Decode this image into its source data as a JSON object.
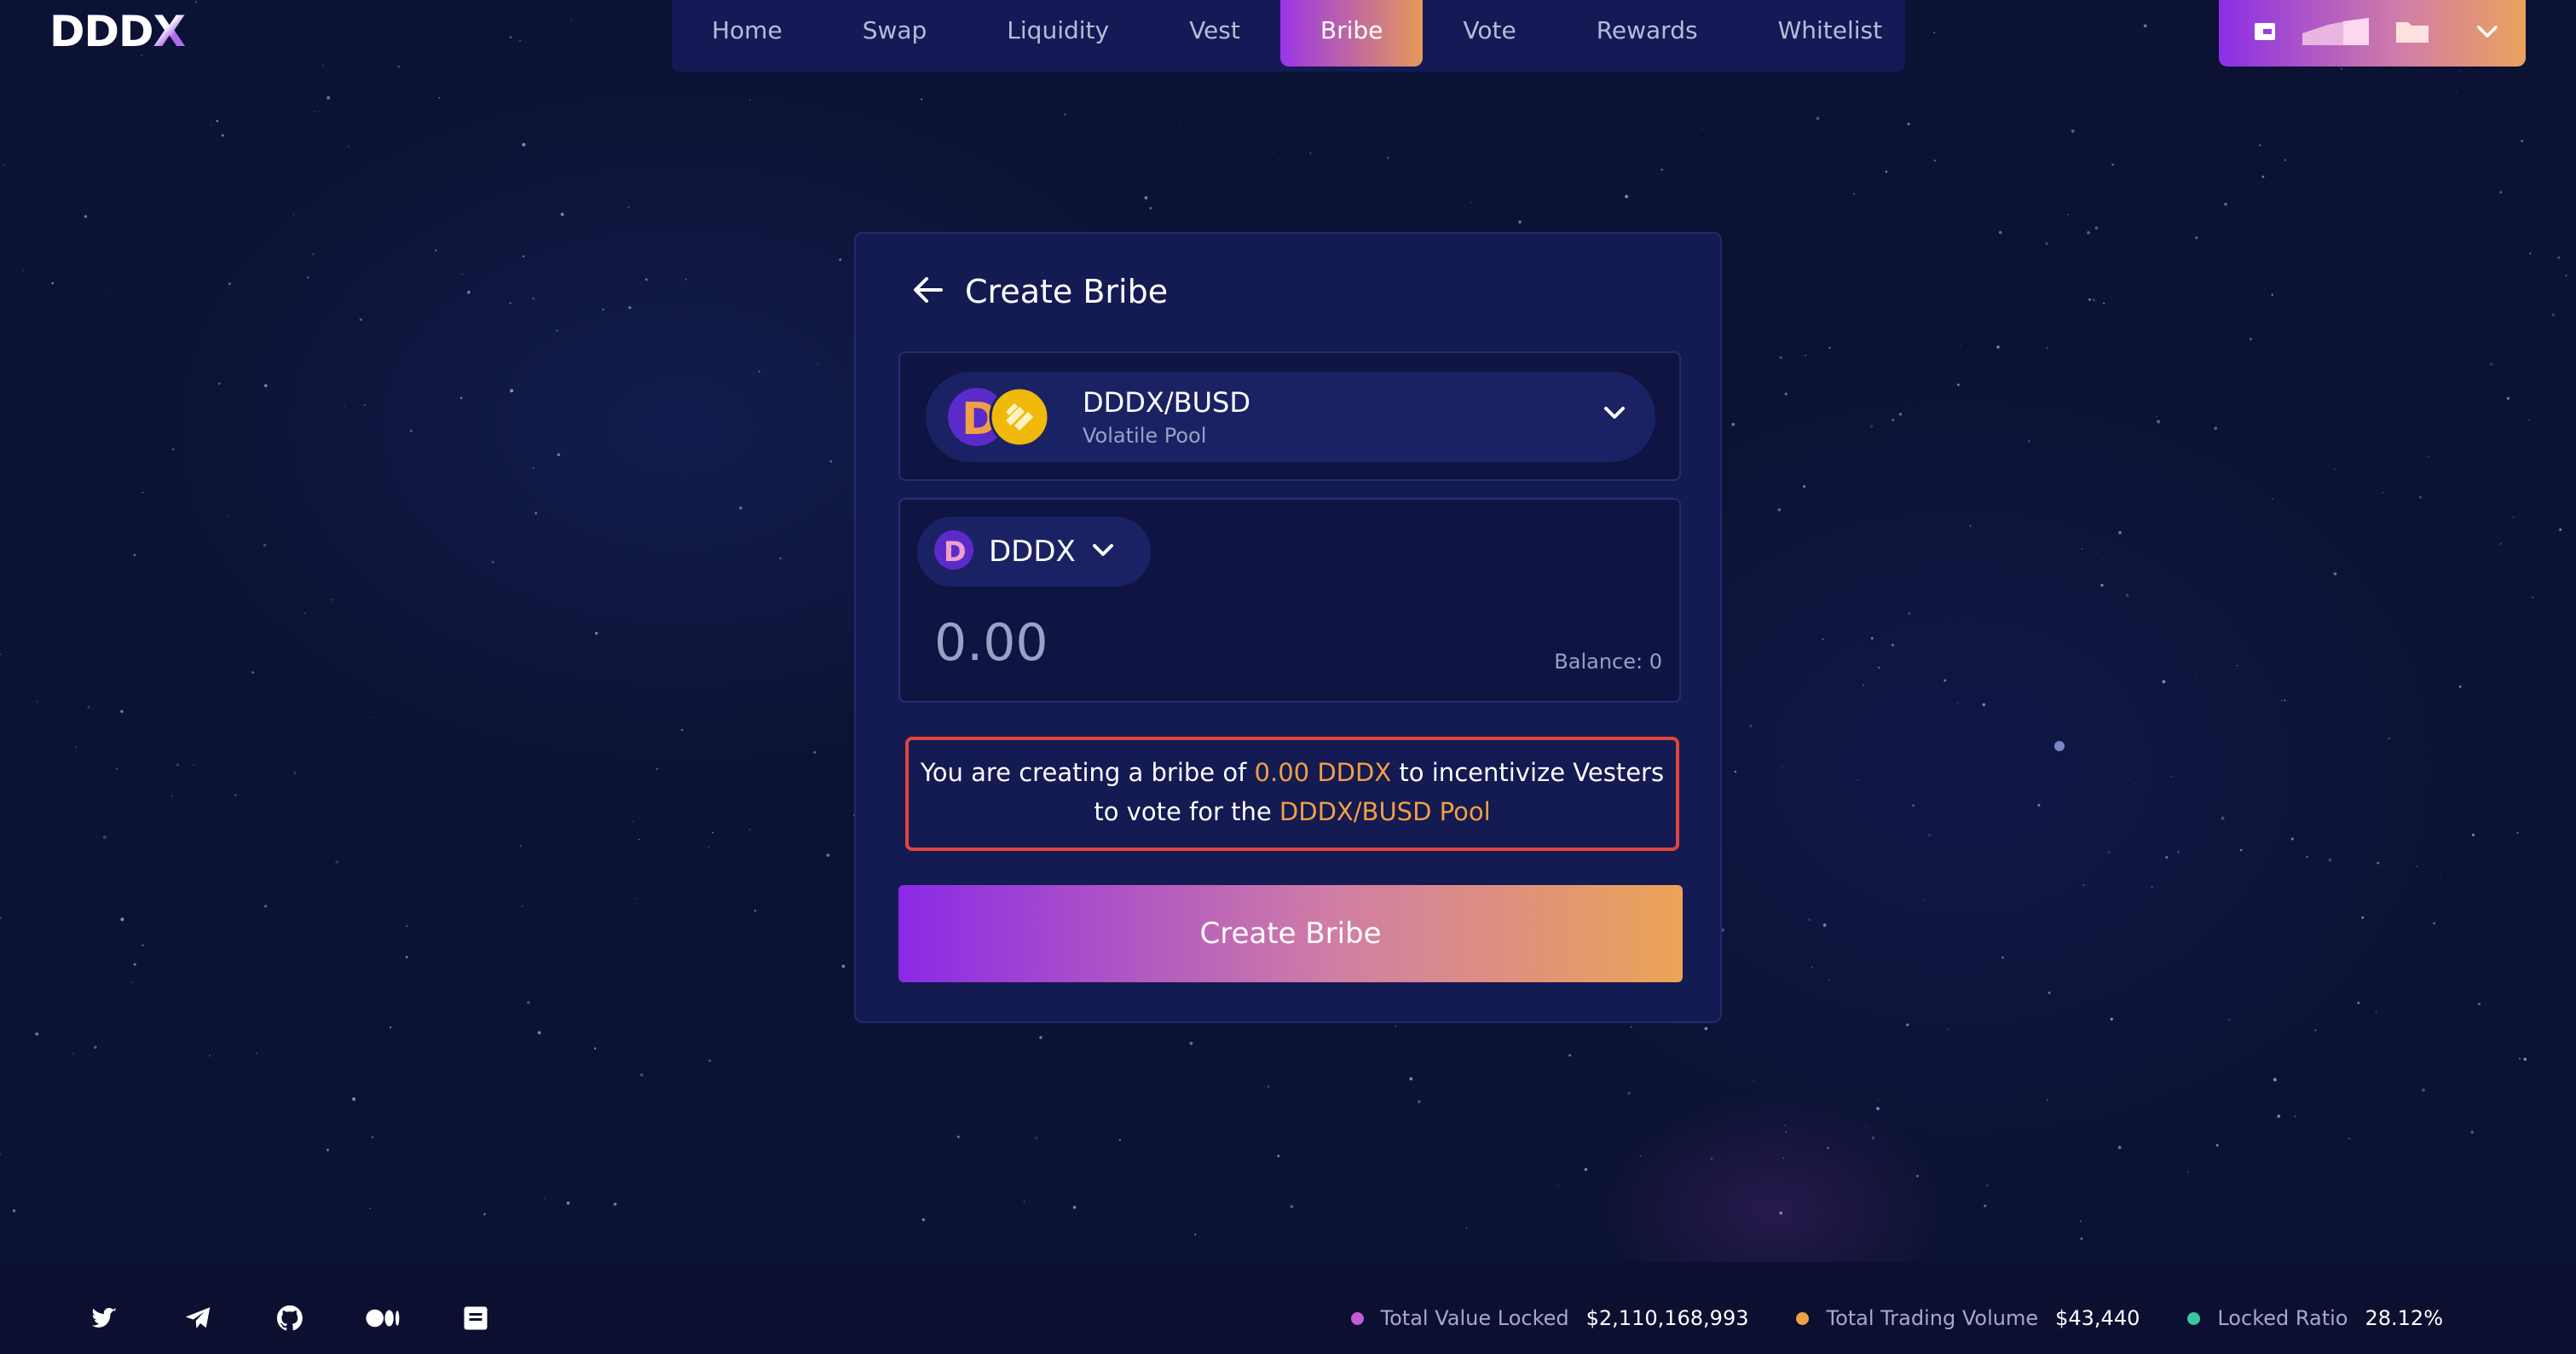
{
  "header": {
    "logo": "DDDX",
    "nav": [
      "Home",
      "Swap",
      "Liquidity",
      "Vest",
      "Bribe",
      "Vote",
      "Rewards",
      "Whitelist"
    ],
    "active_nav": "Bribe"
  },
  "wallet": {
    "icons": [
      "wallet-icon",
      "chart-icon",
      "folder-icon",
      "chevron-down-icon"
    ],
    "colors": [
      "#8a2fe6",
      "#eaa35c"
    ]
  },
  "card": {
    "title": "Create Bribe",
    "pool": {
      "name": "DDDX/BUSD",
      "type": "Volatile Pool"
    },
    "token": {
      "symbol": "DDDX"
    },
    "amount": {
      "placeholder": "0.00",
      "balance": "Balance: 0"
    },
    "notice": {
      "prefix": "You are creating a bribe of ",
      "amount": "0.00 DDDX",
      "middle": " to incentivize Vesters to vote for the ",
      "pool": "DDDX/BUSD Pool"
    },
    "submit": "Create Bribe"
  },
  "footer": {
    "social_icons": [
      "twitter-icon",
      "telegram-icon",
      "github-icon",
      "medium-icon",
      "docs-icon"
    ],
    "stats": [
      {
        "label": "Total Value Locked",
        "value": "$2,110,168,993",
        "color": "#c45ad8"
      },
      {
        "label": "Total Trading Volume",
        "value": "$43,440",
        "color": "#f0a044"
      },
      {
        "label": "Locked Ratio",
        "value": "28.12%",
        "color": "#3cc6a0"
      }
    ]
  },
  "colors": {
    "accent_start": "#8a2ae6",
    "accent_end": "#eba456",
    "highlight": "#f0a044",
    "warning_border": "#e0453d",
    "card_bg": "#141a52",
    "page_bg": "#0b1233"
  }
}
